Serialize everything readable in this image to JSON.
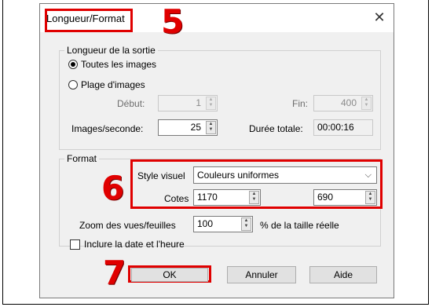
{
  "dialog": {
    "title": "Longueur/Format",
    "close_glyph": "✕"
  },
  "annotations": {
    "step5": "5",
    "step6": "6",
    "step7": "7",
    "color": "#e00000"
  },
  "output_length": {
    "group_title": "Longueur de la sortie",
    "all_images_label": "Toutes les images",
    "range_label": "Plage d'images",
    "start_label": "Début:",
    "start_value": "1",
    "end_label": "Fin:",
    "end_value": "400",
    "fps_label": "Images/seconde:",
    "fps_value": "25",
    "total_duration_label": "Durée totale:",
    "total_duration_value": "00:00:16"
  },
  "format": {
    "group_title": "Format",
    "visual_style_label": "Style visuel",
    "visual_style_value": "Couleurs uniformes",
    "dimensions_label": "Cotes",
    "width_value": "1170",
    "height_value": "690",
    "zoom_label": "Zoom des vues/feuilles",
    "zoom_value": "100",
    "zoom_suffix": "% de la taille réelle"
  },
  "include_datetime_label": "Inclure la date et l'heure",
  "buttons": {
    "ok": "OK",
    "cancel": "Annuler",
    "help": "Aide"
  }
}
